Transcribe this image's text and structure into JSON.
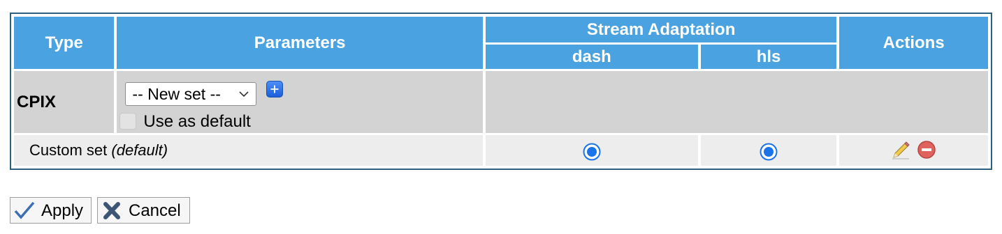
{
  "table": {
    "headers": {
      "type": "Type",
      "parameters": "Parameters",
      "stream_adaptation": "Stream Adaptation",
      "dash": "dash",
      "hls": "hls",
      "actions": "Actions"
    },
    "cpix_row": {
      "type": "CPIX",
      "select_value": "-- New set --",
      "use_as_default_label": "Use as default",
      "use_as_default_checked": false
    },
    "custom_row": {
      "name": "Custom set",
      "suffix": "(default)",
      "dash_selected": true,
      "hls_selected": true
    }
  },
  "buttons": {
    "apply": "Apply",
    "cancel": "Cancel"
  },
  "colors": {
    "header_bg": "#4aa3e0",
    "row_gray": "#d3d3d3",
    "row_light": "#ededed",
    "frame_border": "#2c5f7e",
    "radio_blue": "#1a73e8"
  },
  "icons": {
    "add": "plus-icon",
    "edit": "pencil-icon",
    "delete": "minus-circle-icon",
    "apply": "checkmark-icon",
    "cancel": "x-icon"
  }
}
